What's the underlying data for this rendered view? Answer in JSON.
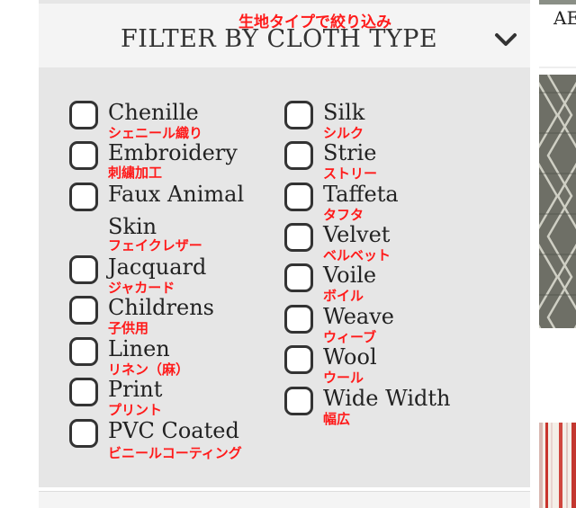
{
  "filter": {
    "title_jp": "生地タイプで絞り込み",
    "title": "FILTER BY CLOTH TYPE",
    "toggle_icon": "chevron-down-icon",
    "left_options": [
      {
        "label": "Chenille",
        "jp": "シェニール織り",
        "checked": false
      },
      {
        "label": "Embroidery",
        "jp": "刺繍加工",
        "checked": false
      },
      {
        "label": "Faux Animal Skin",
        "jp": "フェイクレザー",
        "checked": false
      },
      {
        "label": "Jacquard",
        "jp": "ジャカード",
        "checked": false
      },
      {
        "label": "Childrens",
        "jp": "子供用",
        "checked": false
      },
      {
        "label": "Linen",
        "jp": "リネン（麻）",
        "checked": false
      },
      {
        "label": "Print",
        "jp": "プリント",
        "checked": false
      },
      {
        "label": "PVC Coated",
        "jp": "ビニールコーティング",
        "checked": false
      }
    ],
    "right_options": [
      {
        "label": "Silk",
        "jp": "シルク",
        "checked": false
      },
      {
        "label": "Strie",
        "jp": "ストリー",
        "checked": false
      },
      {
        "label": "Taffeta",
        "jp": "タフタ",
        "checked": false
      },
      {
        "label": "Velvet",
        "jp": "ベルベット",
        "checked": false
      },
      {
        "label": "Voile",
        "jp": "ボイル",
        "checked": false
      },
      {
        "label": "Weave",
        "jp": "ウィーブ",
        "checked": false
      },
      {
        "label": "Wool",
        "jp": "ウール",
        "checked": false
      },
      {
        "label": "Wide Width",
        "jp": "幅広",
        "checked": false
      }
    ]
  },
  "products": {
    "first_card_text": "AE"
  },
  "colors": {
    "annotation_red": "#ff1a1a",
    "panel_bg": "#e6e6e6",
    "header_bg": "#f4f4f4",
    "checkbox_border": "#333333"
  }
}
